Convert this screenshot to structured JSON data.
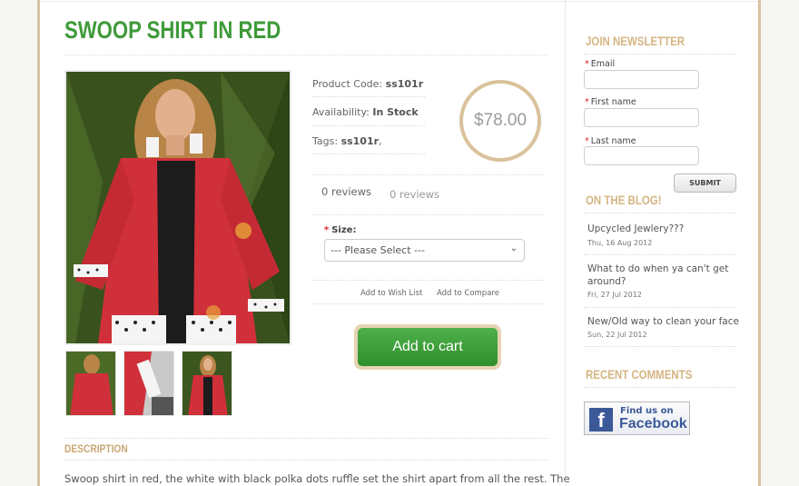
{
  "product": {
    "title": "SWOOP SHIRT IN RED",
    "code_label": "Product Code:",
    "code_value": "ss101r",
    "availability_label": "Availability:",
    "availability_value": "In Stock",
    "tags_label": "Tags:",
    "tags_value": "ss101r",
    "tags_suffix": ",",
    "price": "$78.00",
    "reviews_count": "0 reviews",
    "reviews_link": "0 reviews",
    "size_label": "Size:",
    "size_required": "*",
    "size_selected": "--- Please Select ---",
    "wishlist_label": "Add to Wish List",
    "compare_label": "Add to Compare",
    "cart_label": "Add to cart",
    "description_heading": "DESCRIPTION",
    "description_text": "Swoop shirt in red, the white with black polka dots ruffle set the shirt apart from all the rest. The"
  },
  "sidebar": {
    "newsletter_heading": "JOIN NEWSLETTER",
    "fields": [
      {
        "label": "Email",
        "required": "*",
        "value": ""
      },
      {
        "label": "First name",
        "required": "*",
        "value": ""
      },
      {
        "label": "Last name",
        "required": "*",
        "value": ""
      }
    ],
    "submit_label": "SUBMIT",
    "blog_heading": "ON THE BLOG!",
    "blog_posts": [
      {
        "title": "Upcycled Jewlery???",
        "date": "Thu, 16 Aug 2012"
      },
      {
        "title": "What to do when ya can't get",
        "title2": "around?",
        "date": "Fri, 27 Jul 2012"
      },
      {
        "title": "New/Old way to clean your face",
        "date": "Sun, 22 Jul 2012"
      }
    ],
    "comments_heading": "RECENT COMMENTS",
    "facebook_line1": "Find us on",
    "facebook_line2": "Facebook",
    "facebook_logo": "f"
  },
  "colors": {
    "title_green": "#3f9a3a",
    "accent_tan": "#d5b583",
    "cart_green": "#3a9d36",
    "facebook_blue": "#3b5998"
  }
}
